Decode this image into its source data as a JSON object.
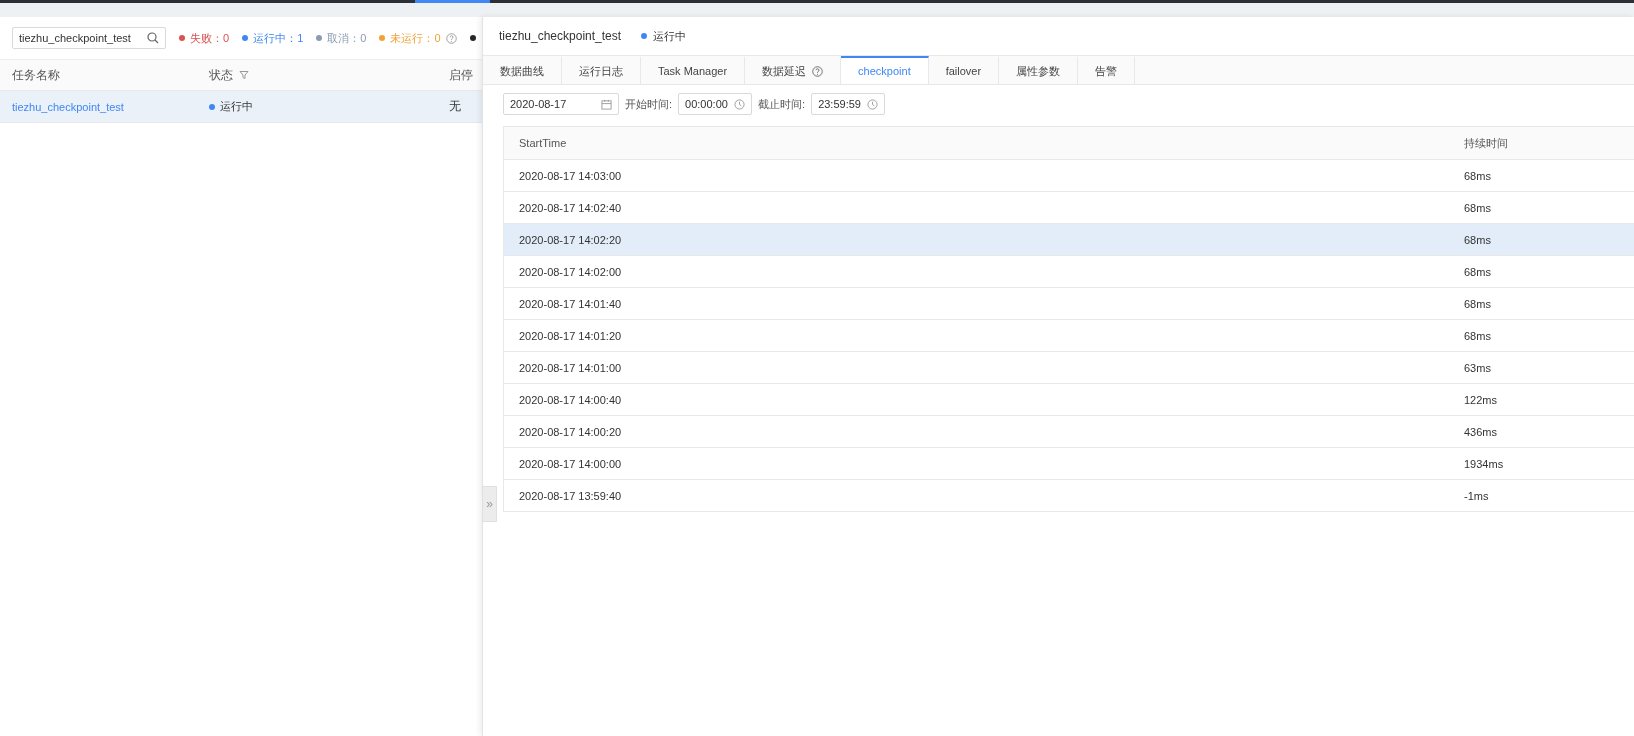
{
  "left_panel": {
    "search": {
      "value": "tiezhu_checkpoint_test"
    },
    "status_counts": [
      {
        "label": "失败：0",
        "color": "#d9534f"
      },
      {
        "label": "运行中：1",
        "color": "#3f87f5"
      },
      {
        "label": "取消：0",
        "color": "#8c9bb5"
      },
      {
        "label": "未运行：0",
        "color": "#f0a236",
        "help": true
      },
      {
        "color": "#262626"
      }
    ],
    "table": {
      "columns": [
        {
          "label": "任务名称",
          "filter": false
        },
        {
          "label": "状态",
          "filter": true
        },
        {
          "label": "启停",
          "filter": false
        }
      ],
      "rows": [
        {
          "name": "tiezhu_checkpoint_test",
          "status": "运行中",
          "color": "#3f87f5",
          "column_3": "无",
          "selected": true
        }
      ]
    }
  },
  "drawer": {
    "title": "tiezhu_checkpoint_test",
    "status": "运行中",
    "color": "#3f87f5",
    "tabs": [
      {
        "label": "数据曲线",
        "selected": false
      },
      {
        "label": "运行日志",
        "selected": false
      },
      {
        "label": "Task Manager",
        "selected": false
      },
      {
        "label": "数据延迟",
        "selected": false,
        "help": true
      },
      {
        "label": "checkpoint",
        "selected": true
      },
      {
        "label": "failover",
        "selected": false
      },
      {
        "label": "属性参数",
        "selected": false
      },
      {
        "label": "告警",
        "selected": false
      }
    ],
    "filters": {
      "date": "2020-08-17",
      "start_label": "开始时间:",
      "start": "00:00:00",
      "end_label": "截止时间:",
      "end": "23:59:59"
    },
    "table": {
      "columns": [
        "StartTime",
        "持续时间"
      ],
      "rows": [
        {
          "start": "2020-08-17 14:03:00",
          "duration": "68ms",
          "selected": false
        },
        {
          "start": "2020-08-17 14:02:40",
          "duration": "68ms",
          "selected": false
        },
        {
          "start": "2020-08-17 14:02:20",
          "duration": "68ms",
          "selected": true
        },
        {
          "start": "2020-08-17 14:02:00",
          "duration": "68ms",
          "selected": false
        },
        {
          "start": "2020-08-17 14:01:40",
          "duration": "68ms",
          "selected": false
        },
        {
          "start": "2020-08-17 14:01:20",
          "duration": "68ms",
          "selected": false
        },
        {
          "start": "2020-08-17 14:01:00",
          "duration": "63ms",
          "selected": false
        },
        {
          "start": "2020-08-17 14:00:40",
          "duration": "122ms",
          "selected": false
        },
        {
          "start": "2020-08-17 14:00:20",
          "duration": "436ms",
          "selected": false
        },
        {
          "start": "2020-08-17 14:00:00",
          "duration": "1934ms",
          "selected": false
        },
        {
          "start": "2020-08-17 13:59:40",
          "duration": "-1ms",
          "selected": false
        }
      ]
    },
    "collapse_handle": "»"
  }
}
